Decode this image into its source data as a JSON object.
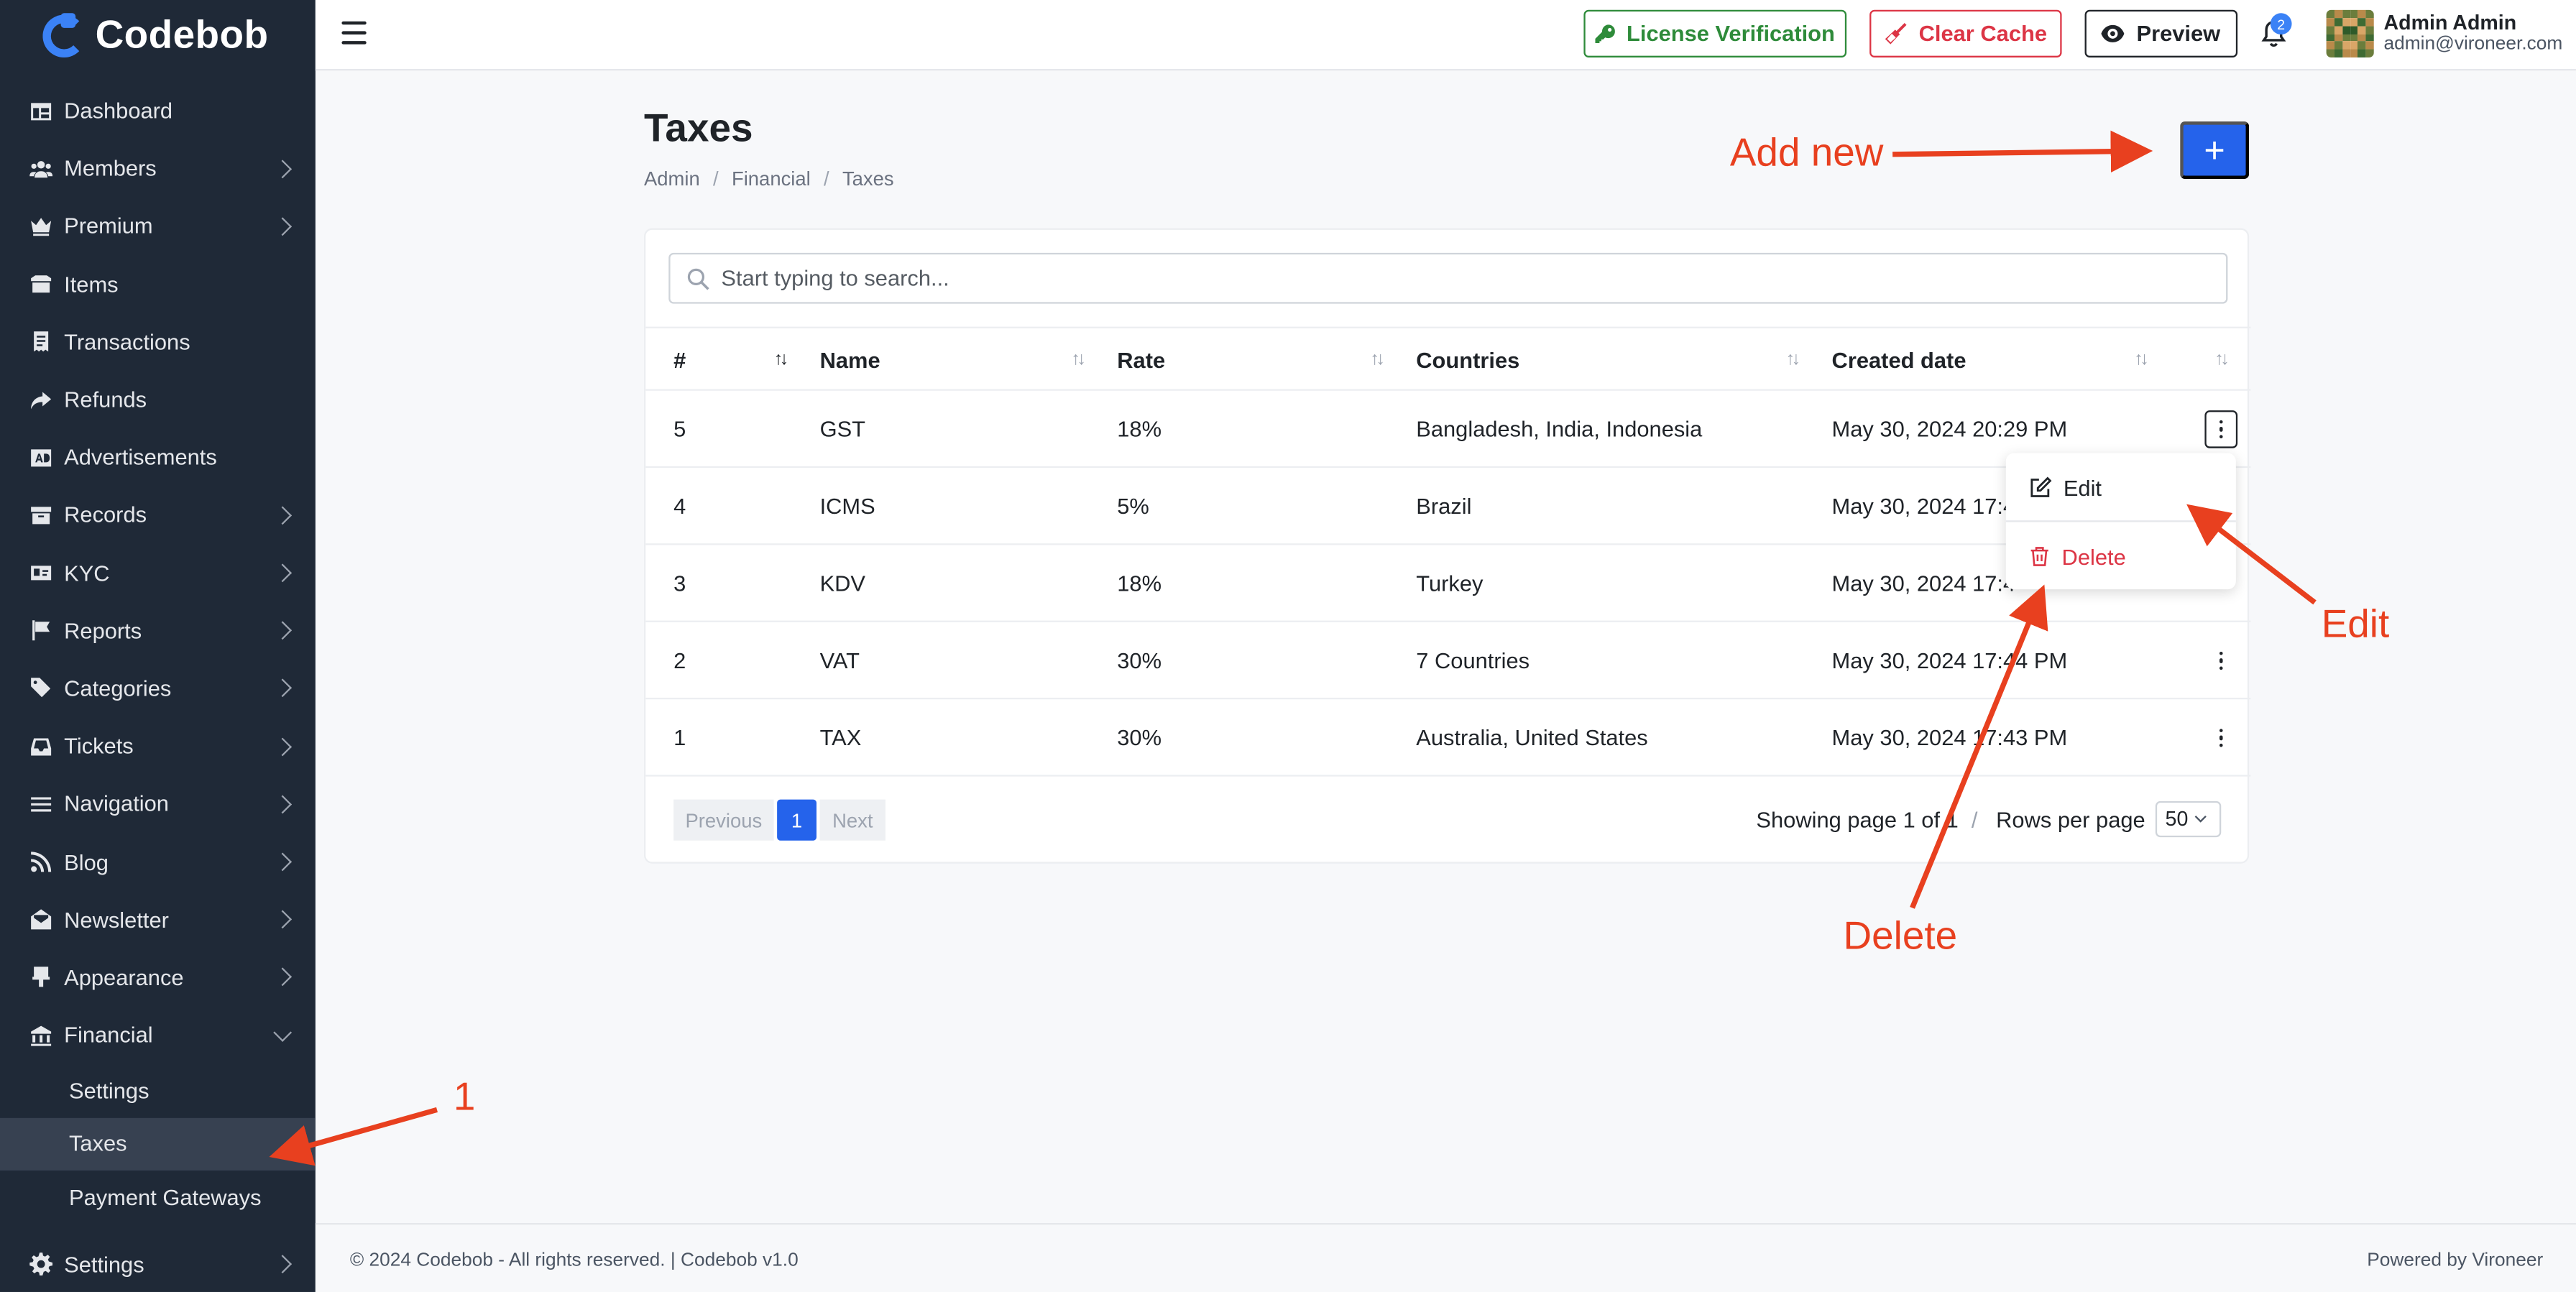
{
  "brand": {
    "name": "Codebob"
  },
  "sidebar": {
    "items": [
      {
        "label": "Dashboard",
        "icon": "dashboard-icon",
        "has_children": false
      },
      {
        "label": "Members",
        "icon": "users-icon",
        "has_children": true
      },
      {
        "label": "Premium",
        "icon": "crown-icon",
        "has_children": true
      },
      {
        "label": "Items",
        "icon": "box-icon",
        "has_children": false
      },
      {
        "label": "Transactions",
        "icon": "receipt-icon",
        "has_children": false
      },
      {
        "label": "Refunds",
        "icon": "share-icon",
        "has_children": false
      },
      {
        "label": "Advertisements",
        "icon": "ad-icon",
        "has_children": false
      },
      {
        "label": "Records",
        "icon": "archive-icon",
        "has_children": true
      },
      {
        "label": "KYC",
        "icon": "id-card-icon",
        "has_children": true
      },
      {
        "label": "Reports",
        "icon": "flag-icon",
        "has_children": true
      },
      {
        "label": "Categories",
        "icon": "tags-icon",
        "has_children": true
      },
      {
        "label": "Tickets",
        "icon": "inbox-icon",
        "has_children": true
      },
      {
        "label": "Navigation",
        "icon": "bars-icon",
        "has_children": true
      },
      {
        "label": "Blog",
        "icon": "rss-icon",
        "has_children": true
      },
      {
        "label": "Newsletter",
        "icon": "envelope-open-icon",
        "has_children": true
      },
      {
        "label": "Appearance",
        "icon": "paint-brush-icon",
        "has_children": true
      },
      {
        "label": "Financial",
        "icon": "bank-icon",
        "has_children": true,
        "expanded": true
      }
    ],
    "financial_sub": [
      {
        "label": "Settings",
        "active": false
      },
      {
        "label": "Taxes",
        "active": true
      },
      {
        "label": "Payment Gateways",
        "active": false
      }
    ],
    "bottom": {
      "label": "Settings",
      "icon": "gear-icon"
    }
  },
  "topbar": {
    "license_label": "License Verification",
    "cache_label": "Clear Cache",
    "preview_label": "Preview",
    "notification_count": "2",
    "user_name": "Admin Admin",
    "user_email": "admin@vironeer.com"
  },
  "page": {
    "title": "Taxes",
    "breadcrumb": [
      "Admin",
      "Financial",
      "Taxes"
    ],
    "add_label": "+"
  },
  "search": {
    "placeholder": "Start typing to search..."
  },
  "table": {
    "columns": [
      "#",
      "Name",
      "Rate",
      "Countries",
      "Created date"
    ],
    "rows": [
      {
        "id": "5",
        "name": "GST",
        "rate": "18%",
        "countries": "Bangladesh, India, Indonesia",
        "created": "May 30, 2024 20:29 PM"
      },
      {
        "id": "4",
        "name": "ICMS",
        "rate": "5%",
        "countries": "Brazil",
        "created": "May 30, 2024 17:4"
      },
      {
        "id": "3",
        "name": "KDV",
        "rate": "18%",
        "countries": "Turkey",
        "created": "May 30, 2024 17:4"
      },
      {
        "id": "2",
        "name": "VAT",
        "rate": "30%",
        "countries": "7 Countries",
        "created": "May 30, 2024 17:44 PM"
      },
      {
        "id": "1",
        "name": "TAX",
        "rate": "30%",
        "countries": "Australia, United States",
        "created": "May 30, 2024 17:43 PM"
      }
    ]
  },
  "row_menu": {
    "edit_label": "Edit",
    "delete_label": "Delete"
  },
  "pagination": {
    "previous_label": "Previous",
    "current_page": "1",
    "next_label": "Next",
    "showing_text": "Showing page 1 of 1",
    "rows_per_page_label": "Rows per page",
    "rows_per_page_value": "50"
  },
  "footer": {
    "copyright": "© 2024 Codebob - All rights reserved. | Codebob v1.0",
    "powered": "Powered by Vironeer"
  },
  "annotations": {
    "add_new": "Add new",
    "edit": "Edit",
    "delete": "Delete",
    "step": "1"
  },
  "colors": {
    "sidebar_bg": "#1f2937",
    "accent": "#2563eb",
    "success": "#2e8b3a",
    "danger": "#dc3545",
    "annotation": "#e8401f"
  }
}
